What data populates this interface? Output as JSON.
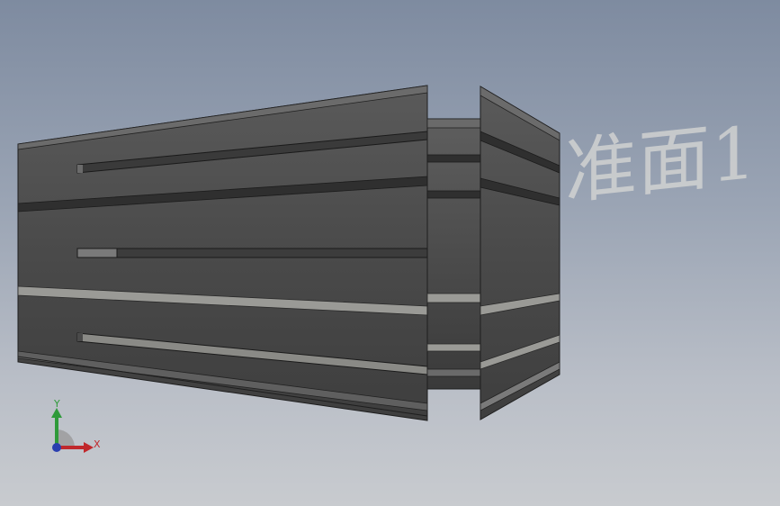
{
  "viewport": {
    "background_top": "#7e8ba0",
    "background_bottom": "#c8cbcf"
  },
  "model": {
    "name": "collet-model",
    "body_color": "#4a4a4a",
    "edge_color": "#1e1e1e",
    "highlight_color": "#9a9a96"
  },
  "reference_plane": {
    "label": "准面1"
  },
  "triad": {
    "x_label": "X",
    "y_label": "Y",
    "x_color": "#c0282c",
    "y_color": "#2f9a3a",
    "z_color": "#2a3fb0"
  }
}
